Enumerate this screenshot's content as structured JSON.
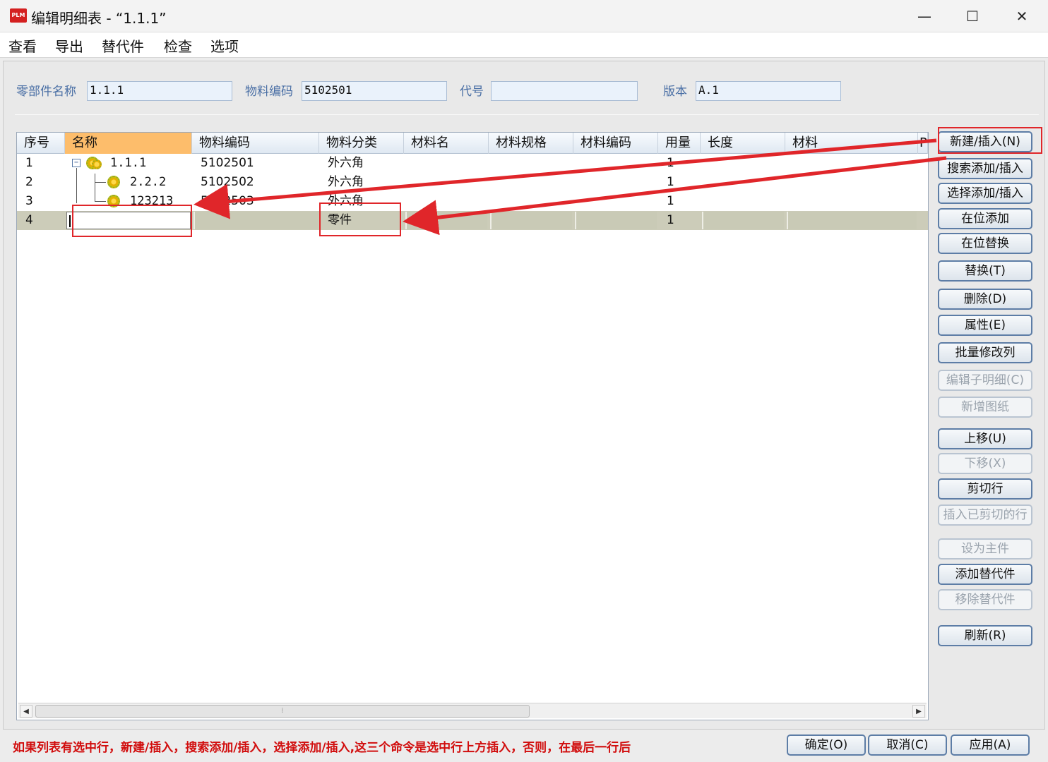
{
  "window": {
    "logo_text": "PLM",
    "title": "编辑明细表 - “1.1.1”",
    "minimize": "—",
    "maximize": "☐",
    "close": "✕"
  },
  "menu": [
    "查看",
    "导出",
    "替代件",
    "检查",
    "选项"
  ],
  "form": {
    "part_name_label": "零部件名称",
    "part_name_value": "1.1.1",
    "material_code_label": "物料编码",
    "material_code_value": "5102501",
    "code_label": "代号",
    "code_value": "",
    "version_label": "版本",
    "version_value": "A.1"
  },
  "table": {
    "columns": [
      "序号",
      "名称",
      "物料编码",
      "物料分类",
      "材料名",
      "材料规格",
      "材料编码",
      "用量",
      "长度",
      "材料",
      "P"
    ],
    "rows": [
      {
        "seq": "1",
        "name": "1.1.1",
        "code": "5102501",
        "category": "外六角",
        "qty": "1"
      },
      {
        "seq": "2",
        "name": "2.2.2",
        "code": "5102502",
        "category": "外六角",
        "qty": "1"
      },
      {
        "seq": "3",
        "name": "123213",
        "code": "5102503",
        "category": "外六角",
        "qty": "1"
      },
      {
        "seq": "4",
        "name": "",
        "code": "",
        "category": "零件",
        "qty": "1"
      }
    ]
  },
  "side_buttons": [
    {
      "label": "新建/插入(N)",
      "enabled": true
    },
    {
      "label": "搜索添加/插入",
      "enabled": true
    },
    {
      "label": "选择添加/插入",
      "enabled": true
    },
    {
      "label": "在位添加",
      "enabled": true
    },
    {
      "label": "在位替换",
      "enabled": true
    },
    {
      "label": "替换(T)",
      "enabled": true
    },
    {
      "label": "删除(D)",
      "enabled": true
    },
    {
      "label": "属性(E)",
      "enabled": true
    },
    {
      "label": "批量修改列",
      "enabled": true
    },
    {
      "label": "编辑子明细(C)",
      "enabled": false
    },
    {
      "label": "新增图纸",
      "enabled": false
    },
    {
      "label": "上移(U)",
      "enabled": true
    },
    {
      "label": "下移(X)",
      "enabled": false
    },
    {
      "label": "剪切行",
      "enabled": true
    },
    {
      "label": "插入已剪切的行",
      "enabled": false
    },
    {
      "label": "设为主件",
      "enabled": false
    },
    {
      "label": "添加替代件",
      "enabled": true
    },
    {
      "label": "移除替代件",
      "enabled": false
    },
    {
      "label": "刷新(R)",
      "enabled": true
    }
  ],
  "footer": {
    "note": "如果列表有选中行，新建/插入，搜索添加/插入，选择添加/插入,这三个命令是选中行上方插入，否则，在最后一行后",
    "ok": "确定(O)",
    "cancel": "取消(C)",
    "apply": "应用(A)"
  },
  "colors": {
    "annotation": "#e0262a",
    "sorted_header": "#fdbd6b",
    "selected_row": "#ccccb9"
  }
}
